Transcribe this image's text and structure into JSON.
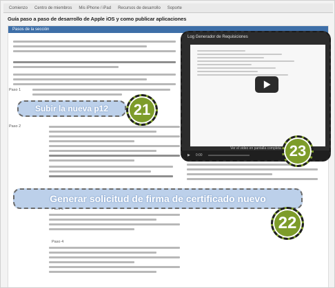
{
  "nav": {
    "items": [
      "Comienzo",
      "Centro de miembros",
      "Mis iPhone / iPad",
      "Recursos de desarrollo",
      "Soporte"
    ]
  },
  "page": {
    "title": "Guía paso a paso de desarrollo de Apple iOS y como publicar aplicaciones",
    "section_header": "Pasos de la sección"
  },
  "steps": {
    "step1_label": "Paso 1",
    "step2_label": "Paso 2",
    "step3_label": "Paso 3",
    "step4_label": "Paso 4"
  },
  "highlights": {
    "upload_p12": "Subir la nueva p12",
    "generate_csr": "Generar solicitud de firma de certificado nuevo"
  },
  "badges": {
    "b21": "21",
    "b22": "22",
    "b23": "23"
  },
  "video": {
    "title": "Log Generador de Requisiciones",
    "caption": "Ver el video en pantalla completa",
    "time": "0:00"
  },
  "colors": {
    "highlight_fill": "#bcd0ea",
    "badge_fill": "#7d9c2a",
    "header_blue": "#3e6fa8"
  }
}
